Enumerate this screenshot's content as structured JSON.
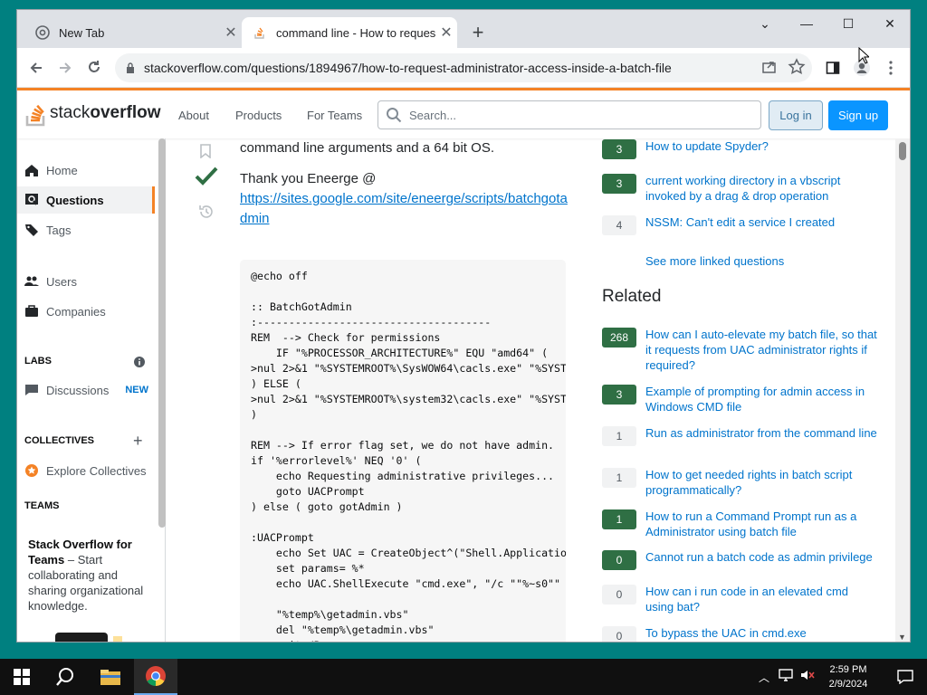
{
  "browser": {
    "tabs": [
      {
        "title": "New Tab",
        "active": false
      },
      {
        "title": "command line - How to request",
        "active": true
      }
    ],
    "url": "stackoverflow.com/questions/1894967/how-to-request-administrator-access-inside-a-batch-file"
  },
  "so": {
    "logo_stack": "stack",
    "logo_overflow": "overflow",
    "nav": [
      "About",
      "Products",
      "For Teams"
    ],
    "search_placeholder": "Search...",
    "login": "Log in",
    "signup": "Sign up"
  },
  "sidebar": {
    "items": [
      {
        "label": "Home",
        "icon": "home-icon"
      },
      {
        "label": "Questions",
        "icon": "questions-icon",
        "active": true
      },
      {
        "label": "Tags",
        "icon": "tag-icon"
      },
      {
        "label": "Users",
        "icon": "users-icon"
      },
      {
        "label": "Companies",
        "icon": "briefcase-icon"
      }
    ],
    "labs": "LABS",
    "discussions": "Discussions",
    "new_badge": "NEW",
    "collectives": "COLLECTIVES",
    "explore_collectives": "Explore Collectives",
    "teams": "TEAMS",
    "teams_title": "Stack Overflow for Teams",
    "teams_dash": " – Start collaborating and sharing organizational knowledge."
  },
  "answer": {
    "text_line": "command line arguments and a 64 bit OS.",
    "thanks": "Thank you Eneerge @",
    "link": "https://sites.google.com/site/eneerge/scripts/batchgotadmin",
    "code": "@echo off\n\n:: BatchGotAdmin\n:-------------------------------------\nREM  --> Check for permissions\n    IF \"%PROCESSOR_ARCHITECTURE%\" EQU \"amd64\" (\n>nul 2>&1 \"%SYSTEMROOT%\\SysWOW64\\cacls.exe\" \"%SYSTEMROOT%\\SysWOW64\\config\\system\"\n) ELSE (\n>nul 2>&1 \"%SYSTEMROOT%\\system32\\cacls.exe\" \"%SYSTEMROOT%\\system32\\config\\system\"\n)\n\nREM --> If error flag set, we do not have admin.\nif '%errorlevel%' NEQ '0' (\n    echo Requesting administrative privileges...\n    goto UACPrompt\n) else ( goto gotAdmin )\n\n:UACPrompt\n    echo Set UAC = CreateObject^(\"Shell.Application\"^) > \"%temp%\\getadmin.vbs\"\n    set params= %*\n    echo UAC.ShellExecute \"cmd.exe\", \"/c \"\"%~s0\"\" %params:\"=\"\"%\", \"\", \"runas\", 1 >> \"%temp%\\getadmin.vbs\"\n\n    \"%temp%\\getadmin.vbs\"\n    del \"%temp%\\getadmin.vbs\"\n    exit /B"
  },
  "linked": [
    {
      "count": "3",
      "answered": true,
      "title": "How to update Spyder?"
    },
    {
      "count": "3",
      "answered": true,
      "title": "current working directory in a vbscript invoked by a drag & drop operation"
    },
    {
      "count": "4",
      "answered": false,
      "title": "NSSM: Can't edit a service I created"
    }
  ],
  "see_more": "See more linked questions",
  "related_title": "Related",
  "related": [
    {
      "count": "268",
      "answered": true,
      "title": "How can I auto-elevate my batch file, so that it requests from UAC administrator rights if required?"
    },
    {
      "count": "3",
      "answered": true,
      "title": "Example of prompting for admin access in Windows CMD file"
    },
    {
      "count": "1",
      "answered": false,
      "title": "Run as administrator from the command line"
    },
    {
      "count": "1",
      "answered": false,
      "title": "How to get needed rights in batch script programmatically?"
    },
    {
      "count": "1",
      "answered": true,
      "title": "How to run a Command Prompt run as a Administrator using batch file"
    },
    {
      "count": "0",
      "answered": true,
      "title": "Cannot run a batch code as admin privilege"
    },
    {
      "count": "0",
      "answered": false,
      "title": "How can i run code in an elevated cmd using bat?"
    },
    {
      "count": "0",
      "answered": false,
      "title": "To bypass the UAC in cmd.exe"
    }
  ],
  "taskbar": {
    "time": "2:59 PM",
    "date": "2/9/2024"
  },
  "colors": {
    "so_orange": "#f48225",
    "so_blue": "#0a95ff",
    "link": "#0074cc",
    "answered_green": "#2f6f44"
  }
}
